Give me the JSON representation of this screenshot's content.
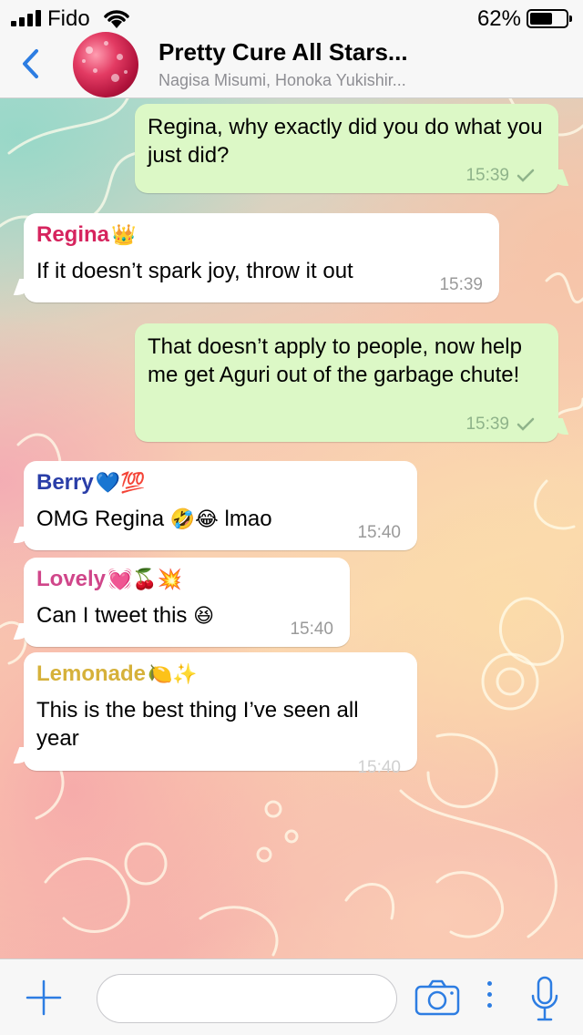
{
  "status_bar": {
    "carrier": "Fido",
    "battery_percent_label": "62%",
    "battery_level": 0.62,
    "signal_bars": 4
  },
  "header": {
    "title": "Pretty Cure All Stars...",
    "subtitle": "Nagisa Misumi, Honoka Yukishir..."
  },
  "messages": [
    {
      "direction": "outgoing",
      "text": "Regina, why exactly did you do what you just did?",
      "time": "15:39",
      "read": true
    },
    {
      "direction": "incoming",
      "sender": "Regina",
      "sender_emoji": "👑",
      "sender_color": "#d6245e",
      "text": "If it doesn’t spark joy, throw it out",
      "time": "15:39"
    },
    {
      "direction": "outgoing",
      "text": "That doesn’t apply to people, now help me get Aguri out of the garbage chute!",
      "time": "15:39",
      "read": true
    },
    {
      "direction": "incoming",
      "sender": "Berry",
      "sender_emoji": "💙💯",
      "sender_color": "#2a3ea8",
      "text": "OMG Regina",
      "text_emoji": "🤣😂",
      "text_after": "lmao",
      "time": "15:40"
    },
    {
      "direction": "incoming",
      "sender": "Lovely",
      "sender_emoji": "💓🍒💥",
      "sender_color": "#d0468a",
      "text": "Can I tweet this",
      "text_emoji": "😆",
      "time": "15:40"
    },
    {
      "direction": "incoming",
      "sender": "Lemonade",
      "sender_emoji": "🍋✨",
      "sender_color": "#d6b13a",
      "text": "This is the best thing I’ve seen all year",
      "time": "15:40"
    }
  ],
  "input_bar": {
    "placeholder": "",
    "icons": [
      "plus-icon",
      "camera-icon",
      "more-icon",
      "microphone-icon"
    ]
  },
  "colors": {
    "accent": "#2d7de2",
    "outgoing_bubble": "#dcf8c6",
    "incoming_bubble": "#ffffff"
  }
}
